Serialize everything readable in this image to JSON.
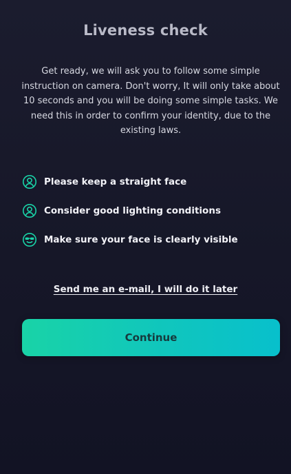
{
  "page": {
    "title": "Liveness check",
    "intro": "Get ready, we will ask you to follow some simple instruction on camera. Don't worry, It will only take about 10 seconds and you will be doing some simple tasks. We need this in order to confirm your identity, due to the existing laws."
  },
  "requirements": [
    {
      "icon": "user-circle-icon",
      "label": "Please keep a straight face"
    },
    {
      "icon": "user-circle-icon",
      "label": "Consider good lighting conditions"
    },
    {
      "icon": "smile-sunglasses-icon",
      "label": "Make sure your face is clearly visible"
    }
  ],
  "actions": {
    "later_link": "Send me an e-mail, I will do it later",
    "continue_label": "Continue"
  },
  "colors": {
    "accent": "#19D3A7",
    "accent_end": "#08C0CC",
    "background": "#161728",
    "button_text": "#163A3D"
  }
}
